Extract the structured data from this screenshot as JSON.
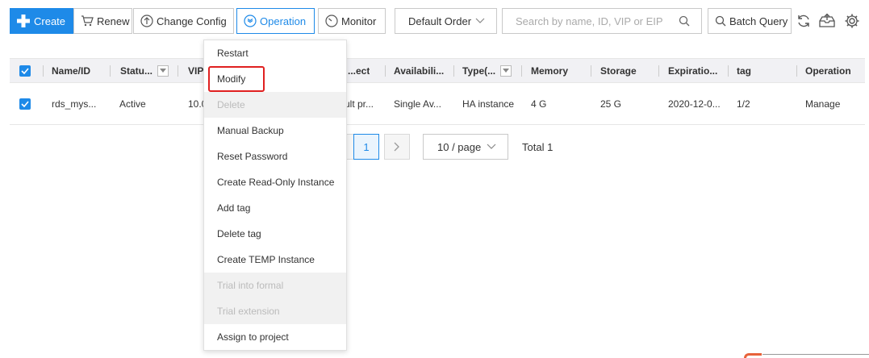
{
  "toolbar": {
    "create": "Create",
    "renew": "Renew",
    "change_config": "Change Config",
    "operation": "Operation",
    "monitor": "Monitor",
    "order_select": "Default Order",
    "search_placeholder": "Search by name, ID, VIP or EIP",
    "batch_query": "Batch Query"
  },
  "table": {
    "headers": [
      "Name/ID",
      "Statu...",
      "VIP",
      "...ect",
      "Availabili...",
      "Type(...",
      "Memory",
      "Storage",
      "Expiratio...",
      "tag",
      "Operation"
    ],
    "rows": [
      {
        "name": "rds_mys...",
        "status": "Active",
        "vip": "10.0",
        "project": "ult pr...",
        "availability": "Single Av...",
        "type": "HA instance",
        "memory": "4 G",
        "storage": "25 G",
        "expiration": "2020-12-0...",
        "tag": "1/2",
        "operation": "Manage"
      }
    ]
  },
  "pagination": {
    "current_page": "1",
    "page_size": "10 / page",
    "total": "Total 1"
  },
  "operation_menu": {
    "items": [
      {
        "label": "Restart",
        "disabled": false
      },
      {
        "label": "Modify",
        "disabled": false
      },
      {
        "label": "Delete",
        "disabled": true
      },
      {
        "label": "Manual Backup",
        "disabled": false
      },
      {
        "label": "Reset Password",
        "disabled": false
      },
      {
        "label": "Create Read-Only Instance",
        "disabled": false
      },
      {
        "label": "Add tag",
        "disabled": false
      },
      {
        "label": "Delete tag",
        "disabled": false
      },
      {
        "label": "Create TEMP Instance",
        "disabled": false
      },
      {
        "label": "Trial into formal",
        "disabled": true
      },
      {
        "label": "Trial extension",
        "disabled": true
      },
      {
        "label": "Assign to project",
        "disabled": false
      }
    ]
  },
  "colors": {
    "accent": "#1e8ae8",
    "active_status": "#21a121",
    "highlight": "#e02020"
  }
}
